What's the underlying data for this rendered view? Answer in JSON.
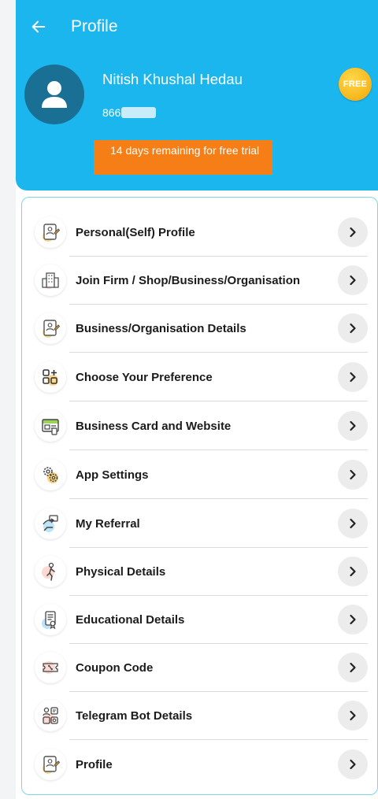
{
  "appbar": {
    "title": "Profile"
  },
  "user": {
    "name": "Nitish Khushal Hedau",
    "phone_visible": "866",
    "trial_text": "14 days remaining for free trial",
    "badge": "FREE"
  },
  "colors": {
    "header": "#1cb6ee",
    "avatar": "#1a6f95",
    "trial_banner": "#f57f16",
    "card_border": "#7fd6e0",
    "badge": "#f7b81e"
  },
  "menu": {
    "items": [
      {
        "label": "Personal(Self) Profile",
        "icon": "profile-card-icon"
      },
      {
        "label": "Join Firm / Shop/Business/Organisation",
        "icon": "building-icon"
      },
      {
        "label": "Business/Organisation Details",
        "icon": "profile-card-icon"
      },
      {
        "label": "Choose Your Preference",
        "icon": "grid-add-icon"
      },
      {
        "label": "Business Card and Website",
        "icon": "business-card-icon"
      },
      {
        "label": "App Settings",
        "icon": "gears-icon"
      },
      {
        "label": "My Referral",
        "icon": "referral-icon"
      },
      {
        "label": "Physical Details",
        "icon": "person-icon"
      },
      {
        "label": "Educational Details",
        "icon": "education-doc-icon"
      },
      {
        "label": "Coupon Code",
        "icon": "coupon-icon"
      },
      {
        "label": "Telegram Bot Details",
        "icon": "telegram-bot-icon"
      },
      {
        "label": "Profile",
        "icon": "profile-card-icon"
      }
    ]
  }
}
